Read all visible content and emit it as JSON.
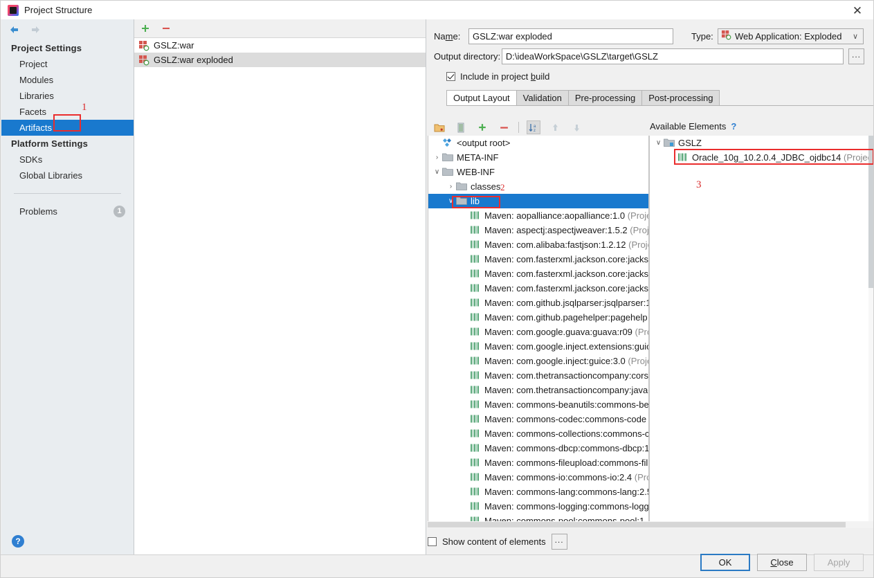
{
  "window": {
    "title": "Project Structure",
    "app_icon": "intellij-idea-icon",
    "close_label": "✕"
  },
  "nav": {
    "back_icon": "back-arrow-icon",
    "forward_icon": "forward-arrow-icon",
    "sections": [
      {
        "title": "Project Settings",
        "items": [
          {
            "label": "Project",
            "selected": false
          },
          {
            "label": "Modules",
            "selected": false
          },
          {
            "label": "Libraries",
            "selected": false
          },
          {
            "label": "Facets",
            "selected": false
          },
          {
            "label": "Artifacts",
            "selected": true
          }
        ]
      },
      {
        "title": "Platform Settings",
        "items": [
          {
            "label": "SDKs",
            "selected": false
          },
          {
            "label": "Global Libraries",
            "selected": false
          }
        ]
      }
    ],
    "problems": {
      "label": "Problems",
      "count": "1"
    },
    "help_label": "?"
  },
  "artifacts": {
    "toolbar": {
      "add_label": "+",
      "remove_label": "−"
    },
    "items": [
      {
        "label": "GSLZ:war",
        "selected": false
      },
      {
        "label": "GSLZ:war exploded",
        "selected": true
      }
    ]
  },
  "detail": {
    "name_label": "Name:",
    "name_value": "GSLZ:war exploded",
    "type_label": "Type:",
    "type_value": "Web Application: Exploded",
    "type_chevron": "∨",
    "output_dir_label": "Output directory:",
    "output_dir_value": "D:\\ideaWorkSpace\\GSLZ\\target\\GSLZ",
    "browse_label": "...",
    "include_in_build_label": "Include in project build",
    "include_in_build_checked": true,
    "tabs": [
      {
        "label": "Output Layout",
        "active": true
      },
      {
        "label": "Validation",
        "active": false
      },
      {
        "label": "Pre-processing",
        "active": false
      },
      {
        "label": "Post-processing",
        "active": false
      }
    ]
  },
  "tree_toolbar": {
    "buttons": [
      {
        "name": "create-directory-icon",
        "enabled": true
      },
      {
        "name": "create-archive-icon",
        "enabled": true
      },
      {
        "name": "add-icon",
        "label": "+",
        "enabled": true
      },
      {
        "name": "remove-icon",
        "label": "−",
        "enabled": true
      },
      {
        "name": "sort-alphabetically-icon",
        "enabled": true,
        "toggled": true
      },
      {
        "name": "move-up-icon",
        "enabled": false
      },
      {
        "name": "move-down-icon",
        "enabled": false
      }
    ]
  },
  "output_tree": {
    "nodes": [
      {
        "label": "<output root>",
        "indent": 0,
        "twist": "",
        "icon": "artifact-root-icon",
        "selected": false
      },
      {
        "label": "META-INF",
        "indent": 0,
        "twist": "›",
        "icon": "folder-icon",
        "selected": false
      },
      {
        "label": "WEB-INF",
        "indent": 0,
        "twist": "∨",
        "icon": "folder-icon",
        "selected": false
      },
      {
        "label": "classes",
        "indent": 1,
        "twist": "›",
        "icon": "folder-icon",
        "selected": false
      },
      {
        "label": "lib",
        "indent": 1,
        "twist": "∨",
        "icon": "folder-icon",
        "selected": true
      },
      {
        "label": "Maven: aopalliance:aopalliance:1.0",
        "suffix": "(Proje",
        "indent": 2,
        "twist": "",
        "icon": "library-icon",
        "selected": false
      },
      {
        "label": "Maven: aspectj:aspectjweaver:1.5.2",
        "suffix": "(Proje",
        "indent": 2,
        "twist": "",
        "icon": "library-icon",
        "selected": false
      },
      {
        "label": "Maven: com.alibaba:fastjson:1.2.12",
        "suffix": "(Proje",
        "indent": 2,
        "twist": "",
        "icon": "library-icon",
        "selected": false
      },
      {
        "label": "Maven: com.fasterxml.jackson.core:jacksc",
        "suffix": "",
        "indent": 2,
        "twist": "",
        "icon": "library-icon",
        "selected": false
      },
      {
        "label": "Maven: com.fasterxml.jackson.core:jacksc",
        "suffix": "",
        "indent": 2,
        "twist": "",
        "icon": "library-icon",
        "selected": false
      },
      {
        "label": "Maven: com.fasterxml.jackson.core:jacksc",
        "suffix": "",
        "indent": 2,
        "twist": "",
        "icon": "library-icon",
        "selected": false
      },
      {
        "label": "Maven: com.github.jsqlparser:jsqlparser:1",
        "suffix": "",
        "indent": 2,
        "twist": "",
        "icon": "library-icon",
        "selected": false
      },
      {
        "label": "Maven: com.github.pagehelper:pagehelp",
        "suffix": "",
        "indent": 2,
        "twist": "",
        "icon": "library-icon",
        "selected": false
      },
      {
        "label": "Maven: com.google.guava:guava:r09",
        "suffix": "(Prc",
        "indent": 2,
        "twist": "",
        "icon": "library-icon",
        "selected": false
      },
      {
        "label": "Maven: com.google.inject.extensions:guic",
        "suffix": "",
        "indent": 2,
        "twist": "",
        "icon": "library-icon",
        "selected": false
      },
      {
        "label": "Maven: com.google.inject:guice:3.0",
        "suffix": "(Proje",
        "indent": 2,
        "twist": "",
        "icon": "library-icon",
        "selected": false
      },
      {
        "label": "Maven: com.thetransactioncompany:cors-",
        "suffix": "",
        "indent": 2,
        "twist": "",
        "icon": "library-icon",
        "selected": false
      },
      {
        "label": "Maven: com.thetransactioncompany:java-",
        "suffix": "",
        "indent": 2,
        "twist": "",
        "icon": "library-icon",
        "selected": false
      },
      {
        "label": "Maven: commons-beanutils:commons-be",
        "suffix": "",
        "indent": 2,
        "twist": "",
        "icon": "library-icon",
        "selected": false
      },
      {
        "label": "Maven: commons-codec:commons-code",
        "suffix": "",
        "indent": 2,
        "twist": "",
        "icon": "library-icon",
        "selected": false
      },
      {
        "label": "Maven: commons-collections:commons-c",
        "suffix": "",
        "indent": 2,
        "twist": "",
        "icon": "library-icon",
        "selected": false
      },
      {
        "label": "Maven: commons-dbcp:commons-dbcp:1",
        "suffix": "",
        "indent": 2,
        "twist": "",
        "icon": "library-icon",
        "selected": false
      },
      {
        "label": "Maven: commons-fileupload:commons-fil",
        "suffix": "",
        "indent": 2,
        "twist": "",
        "icon": "library-icon",
        "selected": false
      },
      {
        "label": "Maven: commons-io:commons-io:2.4",
        "suffix": "(Prc",
        "indent": 2,
        "twist": "",
        "icon": "library-icon",
        "selected": false
      },
      {
        "label": "Maven: commons-lang:commons-lang:2.5",
        "suffix": "",
        "indent": 2,
        "twist": "",
        "icon": "library-icon",
        "selected": false
      },
      {
        "label": "Maven: commons-logging:commons-logg",
        "suffix": "",
        "indent": 2,
        "twist": "",
        "icon": "library-icon",
        "selected": false
      },
      {
        "label": "Maven: commons-pool:commons-pool:1.",
        "suffix": "",
        "indent": 2,
        "twist": "",
        "icon": "library-icon",
        "selected": false
      }
    ]
  },
  "available_elements": {
    "title": "Available Elements",
    "help_label": "?",
    "nodes": [
      {
        "label": "GSLZ",
        "suffix": "",
        "indent": 0,
        "twist": "∨",
        "icon": "module-icon"
      },
      {
        "label": "Oracle_10g_10.2.0.4_JDBC_ojdbc14",
        "suffix": "(Project Li",
        "indent": 1,
        "twist": "",
        "icon": "library-icon"
      }
    ]
  },
  "footer": {
    "show_content_label": "Show content of elements",
    "show_content_checked": false,
    "show_content_dots": "...",
    "buttons": [
      {
        "label": "OK",
        "state": "default"
      },
      {
        "label": "Close",
        "state": "normal"
      },
      {
        "label": "Apply",
        "state": "disabled"
      }
    ]
  },
  "annotations": [
    {
      "id": "1",
      "target": "artifacts-sidebar-item"
    },
    {
      "id": "2",
      "target": "lib-tree-node"
    },
    {
      "id": "3",
      "target": "available-oracle-library"
    }
  ]
}
